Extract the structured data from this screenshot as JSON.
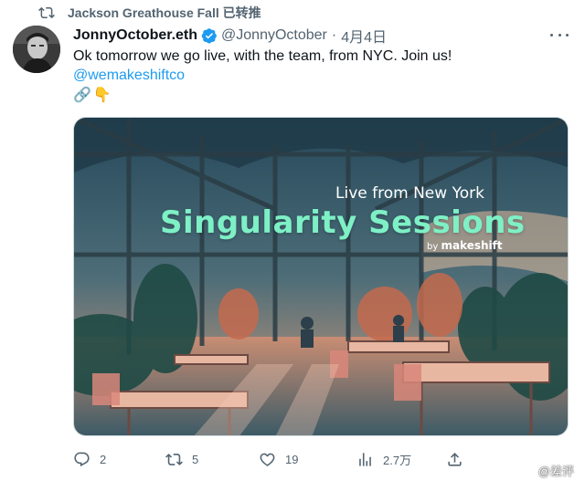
{
  "retweet": {
    "icon": "retweet-icon",
    "text": "Jackson Greathouse Fall 已转推"
  },
  "author": {
    "name": "JonnyOctober.eth",
    "verified_icon": "verified-badge-icon",
    "handle": "@JonnyOctober",
    "separator": "·",
    "date": "4月4日"
  },
  "tweet": {
    "text": "Ok tomorrow we go live, with the team, from NYC. Join us!",
    "mention": "@wemakeshiftco",
    "emojis": [
      "🔗",
      "👇"
    ]
  },
  "media": {
    "subtitle": "Live from New York",
    "title": "Singularity Sessions",
    "by_prefix": "by",
    "brand": "makeshift",
    "title_color": "#7ef0c6"
  },
  "actions": {
    "reply": {
      "icon": "reply-icon",
      "count": "2"
    },
    "retweet": {
      "icon": "retweet-icon",
      "count": "5"
    },
    "like": {
      "icon": "heart-icon",
      "count": "19"
    },
    "views": {
      "icon": "views-icon",
      "count": "2.7万"
    },
    "share": {
      "icon": "share-icon"
    }
  },
  "watermark": "@差评",
  "colors": {
    "accent": "#1d9bf0",
    "muted": "#536471",
    "text": "#0f1419"
  }
}
